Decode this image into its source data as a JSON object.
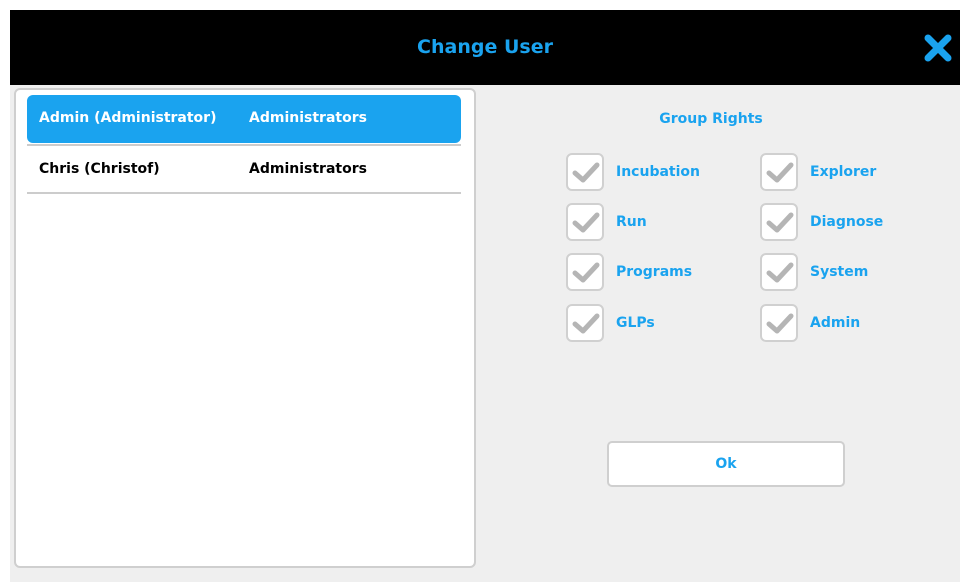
{
  "dialog": {
    "title": "Change User",
    "close_icon": "close-x-icon"
  },
  "users": [
    {
      "name": "Admin (Administrator)",
      "group": "Administrators",
      "selected": true
    },
    {
      "name": "Chris (Christof)",
      "group": "Administrators",
      "selected": false
    }
  ],
  "rights": {
    "title": "Group Rights",
    "items": [
      {
        "label": "Incubation",
        "checked": true
      },
      {
        "label": "Explorer",
        "checked": true
      },
      {
        "label": "Run",
        "checked": true
      },
      {
        "label": "Diagnose",
        "checked": true
      },
      {
        "label": "Programs",
        "checked": true
      },
      {
        "label": "System",
        "checked": true
      },
      {
        "label": "GLPs",
        "checked": true
      },
      {
        "label": "Admin",
        "checked": true
      }
    ]
  },
  "ok_button": {
    "label": "Ok"
  },
  "colors": {
    "accent": "#1aa3ef",
    "titlebar": "#000000",
    "background": "#efefef",
    "check_mark": "#b5b5b5"
  }
}
